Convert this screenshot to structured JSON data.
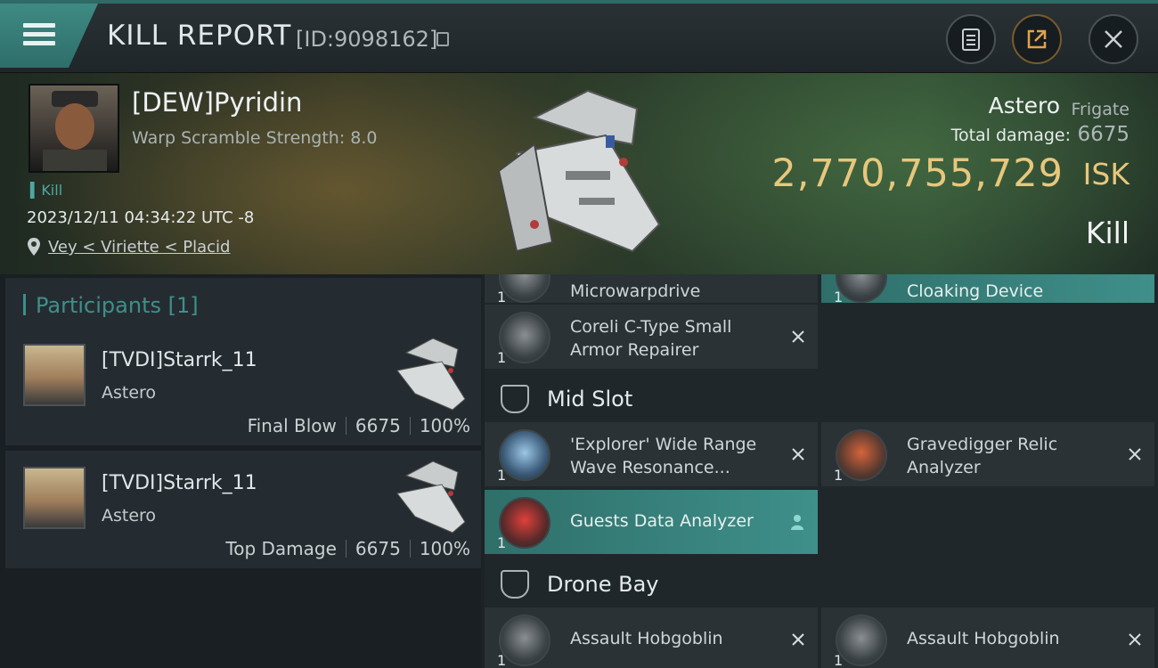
{
  "header": {
    "title": "KILL REPORT",
    "report_id": "[ID:9098162]"
  },
  "victim": {
    "pilot": "[DEW]Pyridin",
    "warp_scramble": "Warp Scramble Strength: 8.0",
    "kill_tag": "Kill",
    "timestamp": "2023/12/11 04:34:22 UTC -8",
    "location": "Vey < Viriette < Placid",
    "ship": "Astero",
    "ship_class": "Frigate",
    "total_damage_label": "Total damage:",
    "total_damage": "6675",
    "isk_value": "2,770,755,729",
    "isk_unit": "ISK",
    "result": "Kill"
  },
  "participants": {
    "title": "Participants [1]",
    "items": [
      {
        "name": "[TVDI]Starrk_11",
        "ship": "Astero",
        "role": "Final Blow",
        "damage": "6675",
        "percent": "100%"
      },
      {
        "name": "[TVDI]Starrk_11",
        "ship": "Astero",
        "role": "Top Damage",
        "damage": "6675",
        "percent": "100%"
      }
    ]
  },
  "fittings": {
    "partial_top": [
      {
        "name": "Microwarpdrive",
        "qty": "1"
      },
      {
        "name": "Cloaking Device",
        "qty": "1"
      }
    ],
    "low": [
      {
        "name": "Coreli C-Type Small Armor Repairer",
        "qty": "1"
      }
    ],
    "mid_title": "Mid Slot",
    "mid": [
      {
        "name": "'Explorer' Wide Range Wave Resonance...",
        "qty": "1"
      },
      {
        "name": "Gravedigger Relic Analyzer",
        "qty": "1"
      },
      {
        "name": "Guests Data Analyzer",
        "qty": "1"
      }
    ],
    "drone_title": "Drone Bay",
    "drones": [
      {
        "name": "Assault Hobgoblin",
        "qty": "1"
      },
      {
        "name": "Assault Hobgoblin",
        "qty": "1"
      }
    ]
  },
  "colors": {
    "accent_teal": "#3f8f8a",
    "isk_gold": "#e7c77c"
  },
  "icons": [
    "menu-icon",
    "copy-icon",
    "clipboard-icon",
    "share-icon",
    "close-icon",
    "location-pin-icon",
    "slot-shield-icon",
    "destroyed-x-icon",
    "person-icon"
  ]
}
